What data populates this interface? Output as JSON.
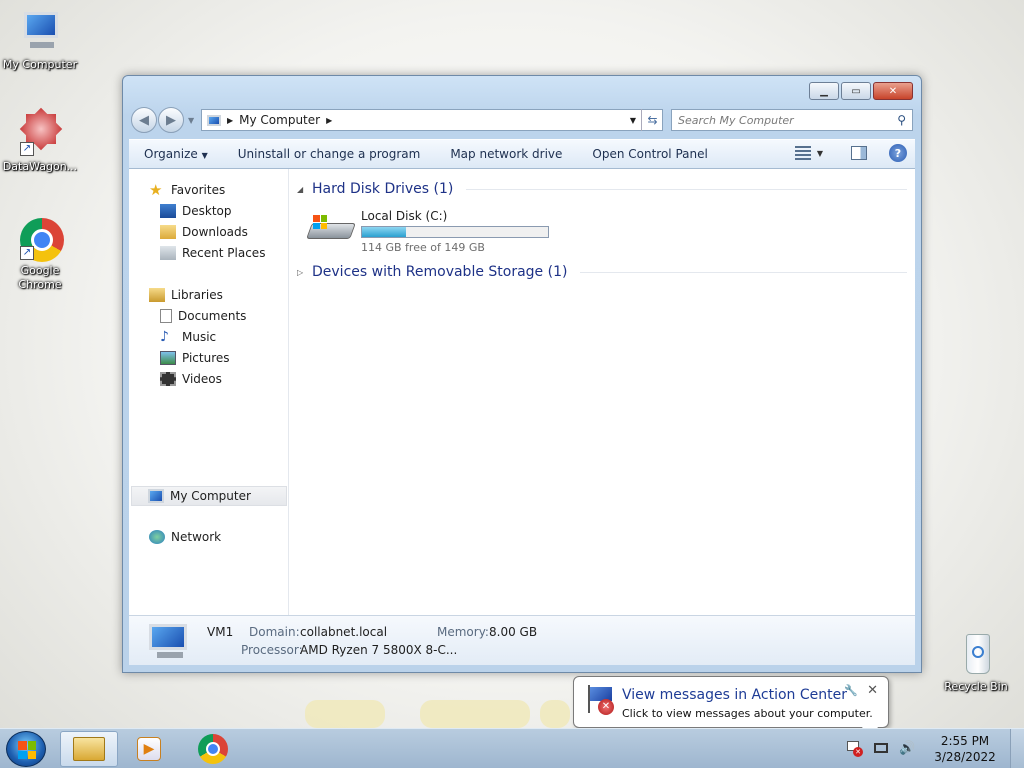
{
  "desktop": {
    "icons": [
      {
        "label": "My Computer"
      },
      {
        "label": "DataWagon..."
      },
      {
        "label": "Google Chrome"
      },
      {
        "label": "Recycle Bin"
      }
    ]
  },
  "window": {
    "address": {
      "crumb": "My Computer"
    },
    "search": {
      "placeholder": "Search My Computer"
    },
    "toolbar": {
      "organize": "Organize",
      "uninstall": "Uninstall or change a program",
      "map_drive": "Map network drive",
      "control_panel": "Open Control Panel",
      "help": "?"
    },
    "nav": {
      "favorites": "Favorites",
      "desktop": "Desktop",
      "downloads": "Downloads",
      "recent": "Recent Places",
      "libraries": "Libraries",
      "documents": "Documents",
      "music": "Music",
      "pictures": "Pictures",
      "videos": "Videos",
      "computer": "My Computer",
      "network": "Network"
    },
    "groups": {
      "hdd": "Hard Disk Drives (1)",
      "removable": "Devices with Removable Storage (1)"
    },
    "drive": {
      "name": "Local Disk (C:)",
      "free_text": "114 GB free of 149 GB",
      "used_fraction": 0.235
    },
    "details": {
      "name": "VM1",
      "domain_label": "Domain:",
      "domain": "collabnet.local",
      "memory_label": "Memory:",
      "memory": "8.00 GB",
      "processor_label": "Processor:",
      "processor": "AMD Ryzen 7 5800X 8-C..."
    }
  },
  "balloon": {
    "title": "View messages in Action Center",
    "message": "Click to view messages about your computer.",
    "close": "✕"
  },
  "taskbar": {
    "time": "2:55 PM",
    "date": "3/28/2022"
  }
}
